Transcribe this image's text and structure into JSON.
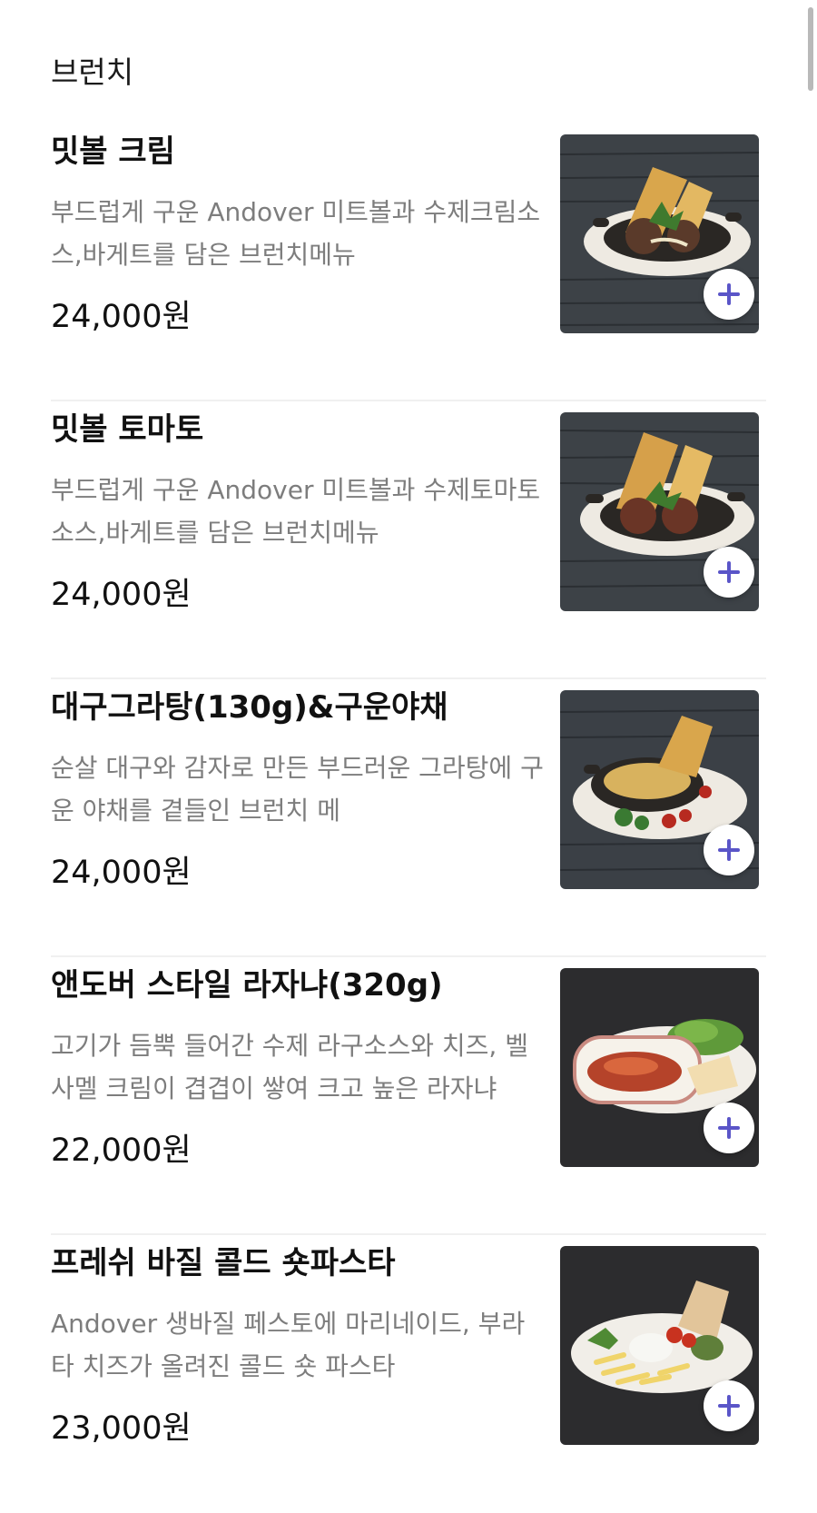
{
  "section": {
    "title": "브런치"
  },
  "menu_items": [
    {
      "name": "밋볼 크림",
      "description": "부드럽게 구운 Andover 미트볼과 수제크림소스,바게트를 담은 브런치메뉴",
      "price": "24,000원",
      "image": "meatball-cream-photo"
    },
    {
      "name": "밋볼 토마토",
      "description": "부드럽게 구운 Andover 미트볼과 수제토마토소스,바게트를 담은 브런치메뉴",
      "price": "24,000원",
      "image": "meatball-tomato-photo"
    },
    {
      "name": "대구그라탕(130g)&구운야채",
      "description": "순살 대구와 감자로 만든 부드러운 그라탕에 구운 야채를 곁들인 브런치 메",
      "price": "24,000원",
      "image": "cod-gratin-photo"
    },
    {
      "name": "앤도버 스타일 라자냐(320g)",
      "description": "고기가 듬뿍 들어간 수제 라구소스와 치즈, 벨사멜 크림이 겹겹이 쌓여 크고 높은 라자냐",
      "price": "22,000원",
      "image": "lasagna-photo"
    },
    {
      "name": "프레쉬 바질 콜드 숏파스타",
      "description": "Andover 생바질 페스토에 마리네이드, 부라타 치즈가 올려진 콜드 숏 파스타",
      "price": "23,000원",
      "image": "basil-pasta-photo"
    }
  ],
  "colors": {
    "accent_plus": "#5a55c8",
    "description_gray": "#7d7d7d"
  },
  "icons": {
    "add": "plus-icon"
  }
}
